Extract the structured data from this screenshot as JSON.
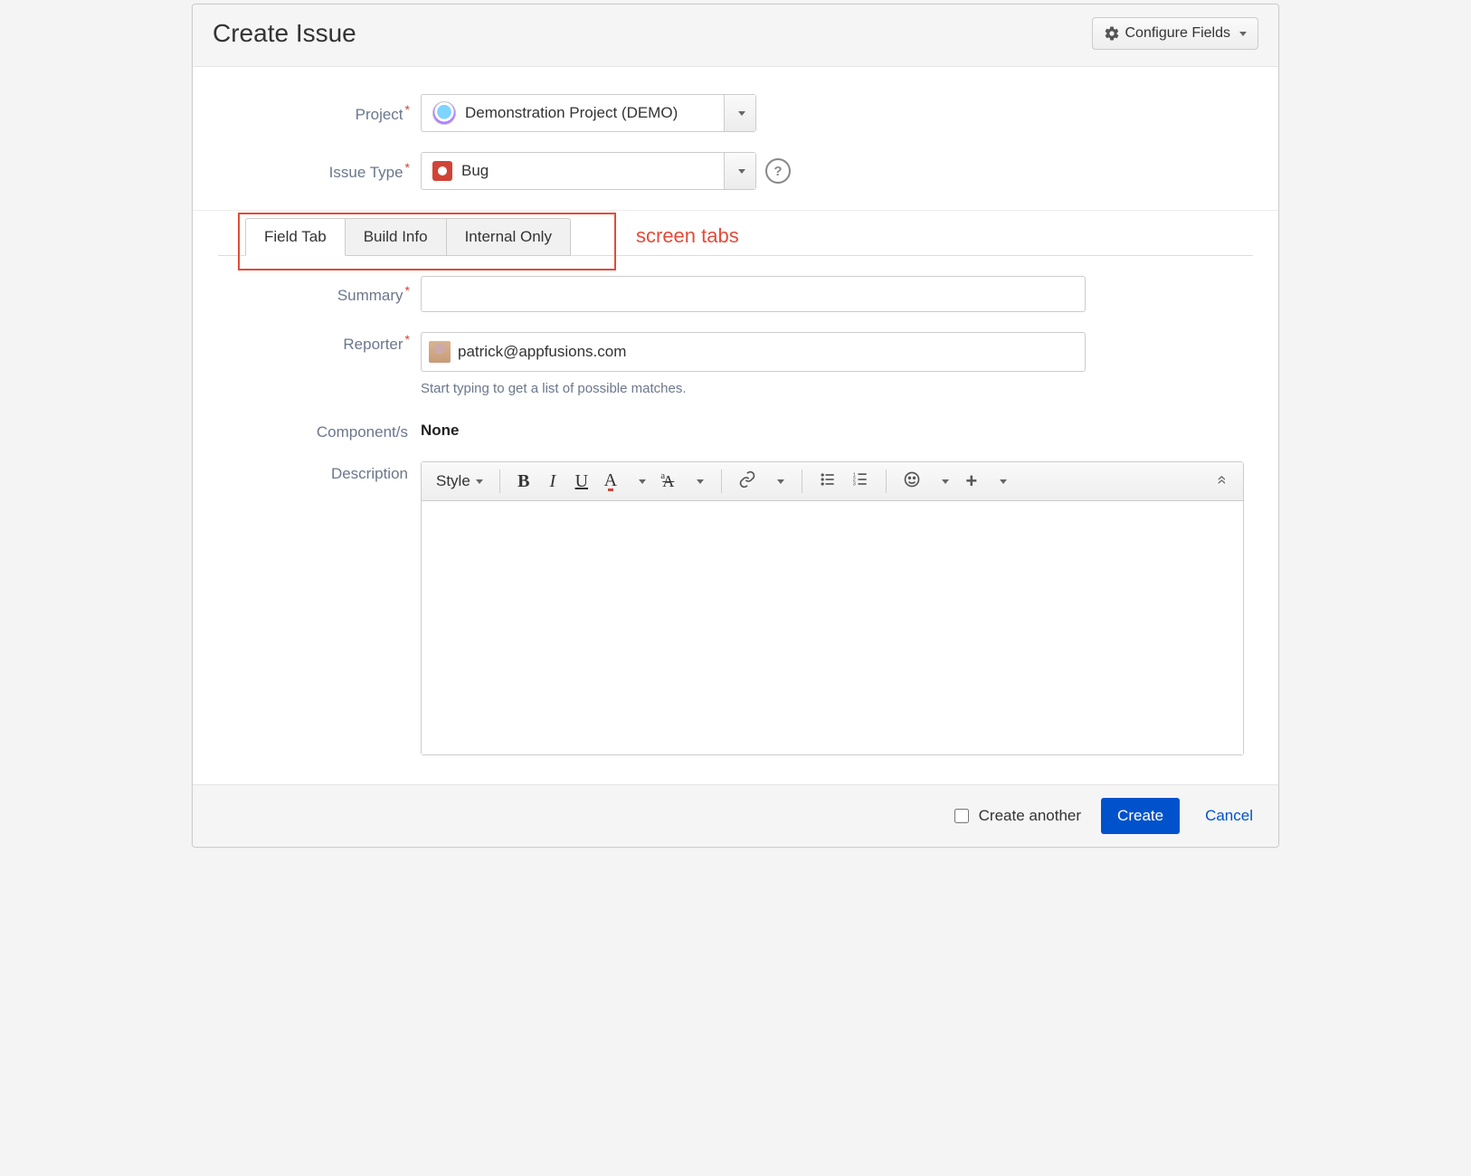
{
  "dialog": {
    "title": "Create Issue",
    "configure_fields_label": "Configure Fields"
  },
  "fields": {
    "project": {
      "label": "Project",
      "value": "Demonstration Project (DEMO)"
    },
    "issue_type": {
      "label": "Issue Type",
      "value": "Bug"
    },
    "summary": {
      "label": "Summary",
      "value": ""
    },
    "reporter": {
      "label": "Reporter",
      "value": "patrick@appfusions.com",
      "helper": "Start typing to get a list of possible matches."
    },
    "components": {
      "label": "Component/s",
      "value": "None"
    },
    "description": {
      "label": "Description"
    }
  },
  "tabs": {
    "items": [
      {
        "label": "Field Tab",
        "active": true
      },
      {
        "label": "Build Info",
        "active": false
      },
      {
        "label": "Internal Only",
        "active": false
      }
    ],
    "annotation": "screen tabs"
  },
  "rte": {
    "style_label": "Style"
  },
  "footer": {
    "create_another_label": "Create another",
    "create_label": "Create",
    "cancel_label": "Cancel"
  }
}
